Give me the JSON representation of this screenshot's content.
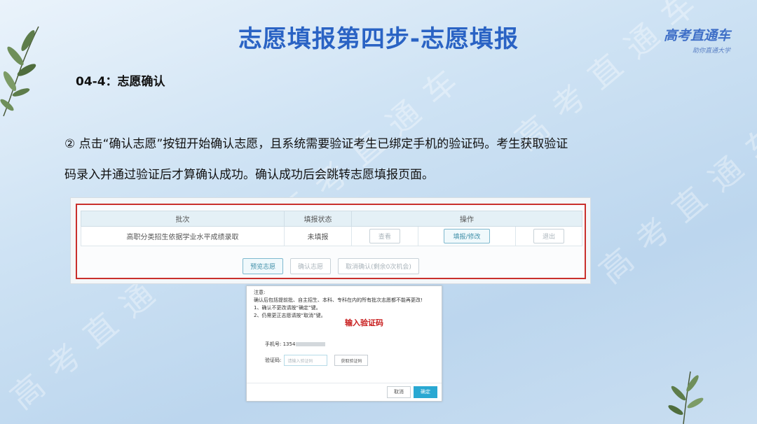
{
  "page": {
    "title": "志愿填报第四步-志愿填报",
    "section_heading": "04-4：志愿确认",
    "paragraph_line1": "② 点击“确认志愿”按钮开始确认志愿，且系统需要验证考生已绑定手机的验证码。考生获取验证",
    "paragraph_line2": "码录入并通过验证后才算确认成功。确认成功后会跳转志愿填报页面。"
  },
  "brand": {
    "name": "高考直通车",
    "slogan": "助你直通大学"
  },
  "watermark": "高考直通车",
  "table": {
    "headers": [
      "批次",
      "填报状态",
      "操作"
    ],
    "row": {
      "batch": "高职分类招生依据学业水平成绩录取",
      "status": "未填报",
      "actions": [
        "查看",
        "填报/修改",
        "退出"
      ]
    },
    "buttons": [
      "预览志愿",
      "确认志愿",
      "取消确认(剩余0次机会)"
    ]
  },
  "dialog": {
    "notice_title": "注意:",
    "notice_body": "确认后包括提前批、自主招生、本科、专科在内的所有批次志愿都不能再更改!",
    "notice_item1": "1、确认不更改请按“确定”键。",
    "notice_item2": "2、仍需更正志愿请按“取消”键。",
    "red_label": "输入验证码",
    "phone_label": "手机号: 1354",
    "code_label": "验证码:",
    "code_placeholder": "请输入验证码",
    "get_code": "获取验证码",
    "cancel": "取消",
    "confirm": "确定"
  },
  "colors": {
    "title": "#2a63c4",
    "red_border": "#c9302c",
    "confirm_btn": "#29a8d2"
  }
}
